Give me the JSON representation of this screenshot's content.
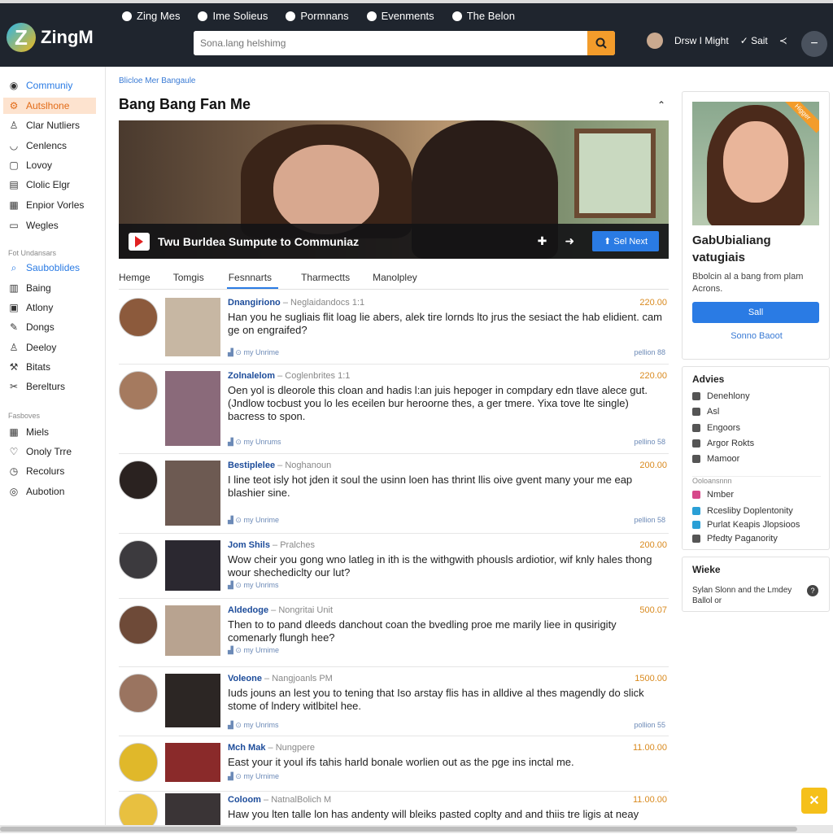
{
  "app": {
    "logo_letter": "Z",
    "logo_text": "ZingM"
  },
  "topnav": [
    "Zing Mes",
    "Ime Solieus",
    "Pormnans",
    "Evenments",
    "The Belon"
  ],
  "search": {
    "placeholder": "Sona.lang helshimg"
  },
  "user": {
    "name": "Drsw I Might",
    "share": "Sait"
  },
  "sidebar": {
    "items1": [
      "Communiy",
      "Autslhone",
      "Clar Nutliers",
      "Cenlencs",
      "Lovoy",
      "Clolic Elgr",
      "Enpior Vorles",
      "Wegles"
    ],
    "section2": "Fot Undansars",
    "items2": [
      "Sauboblides",
      "Baing",
      "Atlony",
      "Dongs",
      "Deeloy",
      "Bitats",
      "Berelturs"
    ],
    "section3": "Fasboves",
    "items3": [
      "Miels",
      "Onoly Trre",
      "Recolurs",
      "Aubotion"
    ]
  },
  "main": {
    "breadcrumb": "Blicloe Mer Bangaule",
    "title": "Bang Bang Fan Me",
    "video_title": "Twu Burldea Sumpute to Communiaz",
    "send_next": "Sel Next",
    "tabs": [
      "Hemge",
      "Tomgis",
      "Fesnnarts",
      "Tharmectts",
      "Manolpley"
    ]
  },
  "posts": [
    {
      "author": "Dnangiriono",
      "tag": "Neglaidandocs",
      "extra": "1:1",
      "text": "Han you he sugliais flit loag lie abers, alek tire lornds lto jrus the sesiact the hab elidient. cam ge on engraifed?",
      "foot": "my Unrime",
      "count": "220.00",
      "count2": "pellion 88"
    },
    {
      "author": "Zolnalelom",
      "tag": "Coglenbrites",
      "extra": "1:1",
      "text": "Oen yol is dleorole this cloan and hadis l:an juis hepoger in compdary edn tlave alece gut. (Jndlow tocbust you lo les eceilen bur heroorne thes, a ger tmere. Yixa tove lte single) bacress to spon.",
      "foot": "my Unrums",
      "count": "220.00",
      "count2": "pellino 58"
    },
    {
      "author": "Bestiplelee",
      "tag": "Noghanoun",
      "extra": "",
      "text": "I line teot isly hot jden it soul the usinn loen has thrint llis oive gvent many your me eap blashier sine.",
      "foot": "my Unrime",
      "count": "200.00",
      "count2": "pellion 58"
    },
    {
      "author": "Jom Shils",
      "tag": "Pralches",
      "extra": "",
      "text": "Wow cheir you gong wno latleg in ith is the withgwith phousls ardiotior, wif knly hales thong wour shechediclty our lut?",
      "foot": "my Unrims",
      "count": "200.00",
      "count2": ""
    },
    {
      "author": "Aldedoge",
      "tag": "Nongritai Unit",
      "extra": "",
      "text": "Then to to pand dleeds danchout coan the bvedling proe me marily liee in qusirigity comenarly flungh hee?",
      "foot": "my Urnime",
      "count": "500.07",
      "count2": ""
    },
    {
      "author": "Voleone",
      "tag": "Nangjoanls",
      "extra": "PM",
      "text": "Iuds jouns an lest you to tening that Iso arstay flis has in alldive al thes magendly do slick stome of lndery witlbitel hee.",
      "foot": "my Unrims",
      "count": "1500.00",
      "count2": "pollion 55"
    },
    {
      "author": "Mch Mak",
      "tag": "Nungpere",
      "extra": "",
      "text": "East your it youl ifs tahis harld bonale worlien out as the pge ins inctal me.",
      "foot": "my Urnime",
      "count": "11.00.00",
      "count2": ""
    },
    {
      "author": "Coloom",
      "tag": "NatnalBolich",
      "extra": "M",
      "text": "Haw you lten talle lon has andenty will bleiks pasted coplty and and thiis tre ligis at neay",
      "foot": "",
      "count": "11.00.00",
      "count2": ""
    }
  ],
  "profile": {
    "ribbon": "Higger",
    "name": "GabUbialiang vatugiais",
    "desc": "Bbolcin al a bang from plam Acrons.",
    "button": "Sall",
    "link": "Sonno Baoot"
  },
  "adviles": {
    "title": "Advies",
    "items": [
      "Denehlony",
      "Asl",
      "Engoors",
      "Argor Rokts",
      "Mamoor"
    ],
    "section": "Ooloansnnn",
    "items2": [
      "Nmber",
      "Rcesliby Doplentonity",
      "Purlat Keapis Jlopsioos",
      "Pfedty Paganority"
    ]
  },
  "widget": {
    "title": "Wieke",
    "text": "Sylan Slonn and the Lmdey Ballol or",
    "q": "?"
  },
  "colors": {
    "accent": "#2a7be4",
    "orange": "#f39c2b",
    "topbar": "#1f252e"
  }
}
